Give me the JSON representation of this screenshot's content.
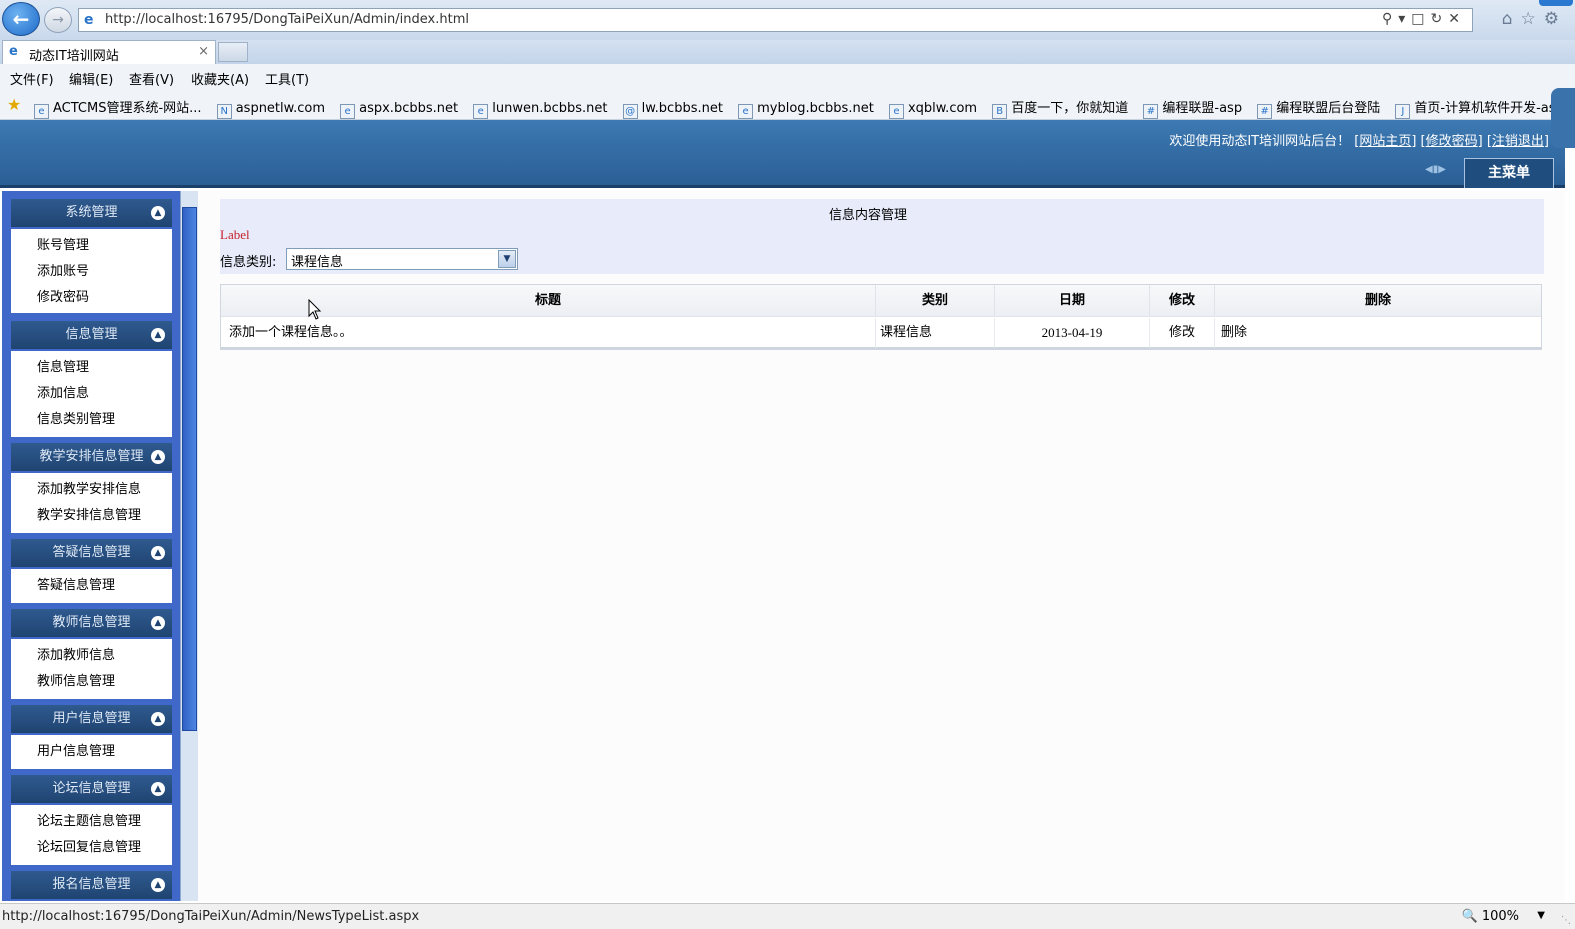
{
  "browser": {
    "url": "http://localhost:16795/DongTaiPeiXun/Admin/index.html",
    "tab_title": "动态IT培训网站",
    "tab_close": "×",
    "menu": [
      "文件(F)",
      "编辑(E)",
      "查看(V)",
      "收藏夹(A)",
      "工具(T)"
    ],
    "favorites": [
      "ACTCMS管理系统-网站...",
      "aspnetlw.com",
      "aspx.bcbbs.net",
      "lunwen.bcbbs.net",
      "lw.bcbbs.net",
      "myblog.bcbbs.net",
      "xqblw.com",
      "百度一下，你就知道",
      "编程联盟-asp",
      "编程联盟后台登陆",
      "首页-计算机软件开发-as..."
    ],
    "status_url": "http://localhost:16795/DongTaiPeiXun/Admin/NewsTypeList.aspx",
    "zoom": "100%"
  },
  "header": {
    "welcome": "欢迎使用动态IT培训网站后台！",
    "links": [
      "网站主页",
      "修改密码",
      "注销退出"
    ],
    "main_menu": "主菜单"
  },
  "sidebar": {
    "groups": [
      {
        "title": "系统管理",
        "items": [
          "账号管理",
          "添加账号",
          "修改密码"
        ]
      },
      {
        "title": "信息管理",
        "items": [
          "信息管理",
          "添加信息",
          "信息类别管理"
        ]
      },
      {
        "title": "教学安排信息管理",
        "items": [
          "添加教学安排信息",
          "教学安排信息管理"
        ]
      },
      {
        "title": "答疑信息管理",
        "items": [
          "答疑信息管理"
        ]
      },
      {
        "title": "教师信息管理",
        "items": [
          "添加教师信息",
          "教师信息管理"
        ]
      },
      {
        "title": "用户信息管理",
        "items": [
          "用户信息管理"
        ]
      },
      {
        "title": "论坛信息管理",
        "items": [
          "论坛主题信息管理",
          "论坛回复信息管理"
        ]
      },
      {
        "title": "报名信息管理",
        "items": []
      }
    ]
  },
  "content": {
    "title": "信息内容管理",
    "label": "Label",
    "filter_label": "信息类别:",
    "filter_value": "课程信息",
    "table": {
      "headers": [
        "标题",
        "类别",
        "日期",
        "修改",
        "删除"
      ],
      "rows": [
        [
          "添加一个课程信息。。",
          "课程信息",
          "2013-04-19",
          "修改",
          "删除"
        ]
      ]
    }
  }
}
